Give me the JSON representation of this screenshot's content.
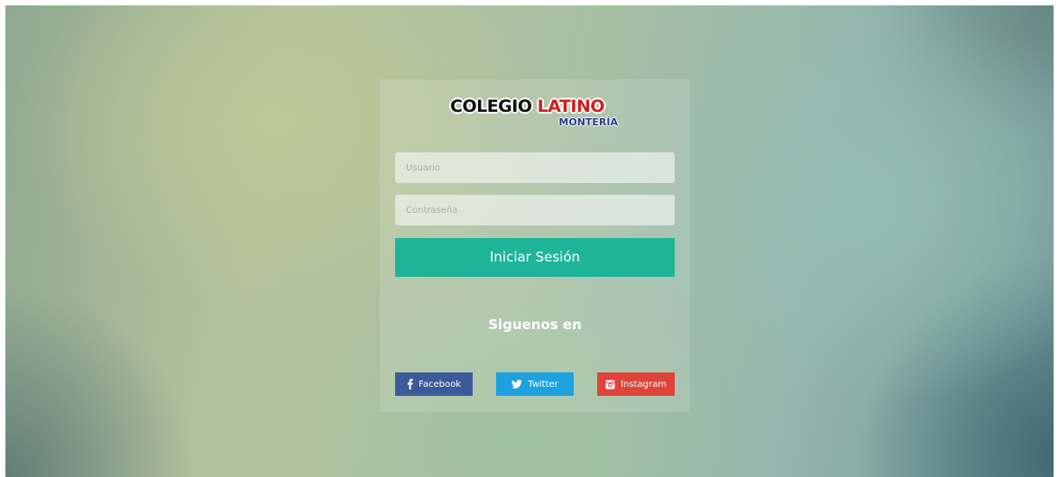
{
  "logo": {
    "line1_part1": "COLEGIO",
    "line1_part2": "LATINO",
    "line2": "MONTERÍA"
  },
  "form": {
    "username_placeholder": "Usuario",
    "username_value": "",
    "password_placeholder": "Contraseña",
    "password_value": "",
    "submit_label": "Iniciar Sesión"
  },
  "follow": {
    "heading": "Siguenos en"
  },
  "social": [
    {
      "label": "Facebook",
      "icon": "facebook-icon",
      "color": "#3b5a99"
    },
    {
      "label": "Twitter",
      "icon": "twitter-icon",
      "color": "#1da1e0"
    },
    {
      "label": "Instagram",
      "icon": "instagram-icon",
      "color": "#e0433a"
    }
  ],
  "colors": {
    "primary_button": "#1eb49a"
  }
}
